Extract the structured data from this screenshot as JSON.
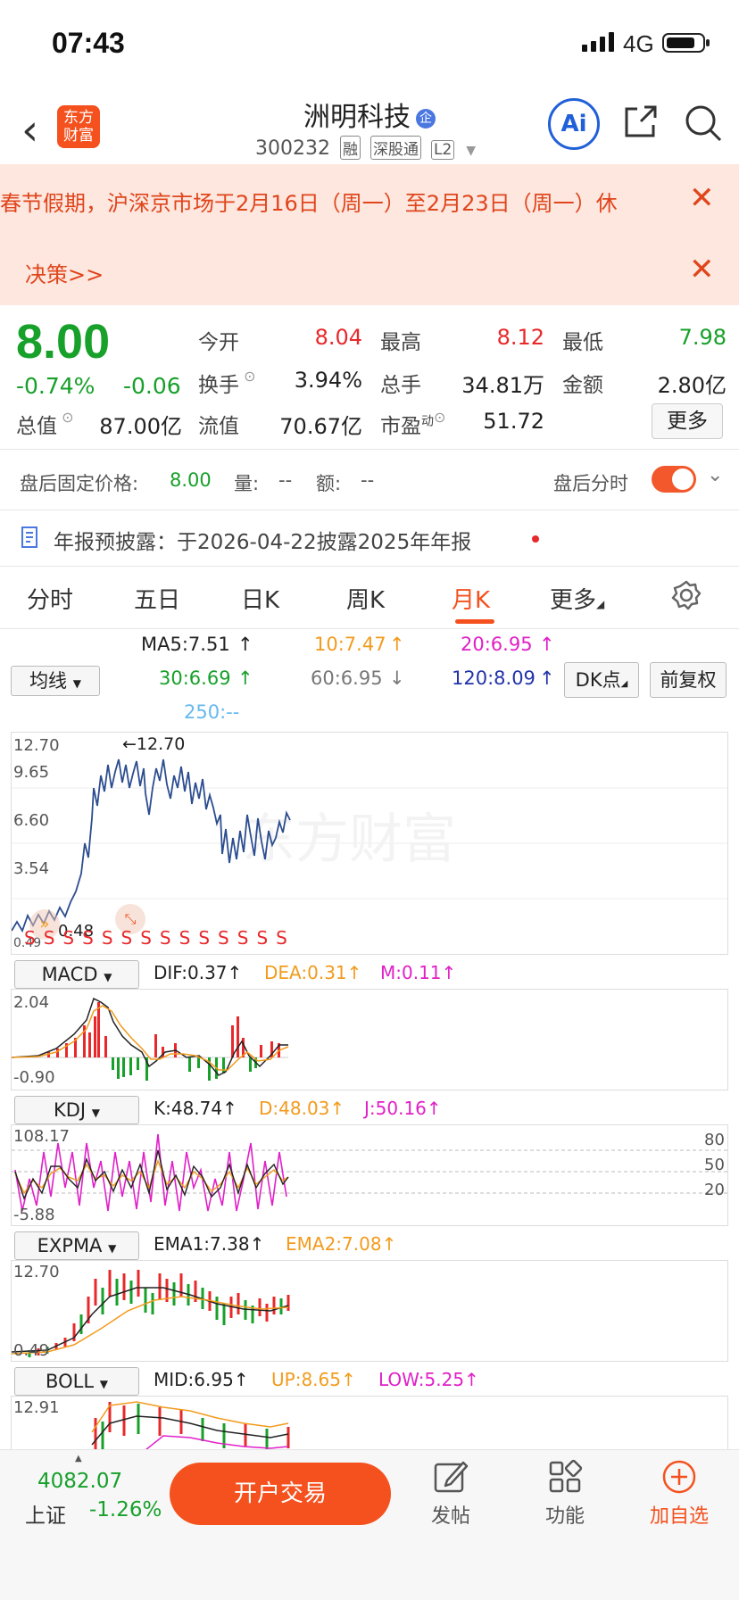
{
  "status_bar": {
    "time": "07:43",
    "network": "4G"
  },
  "header": {
    "logo_text": "东方财富",
    "stock_name": "洲明科技",
    "stock_badge": "企",
    "stock_code": "300232",
    "tags": [
      "融",
      "深股通",
      "L2"
    ],
    "ai_label": "Ai"
  },
  "banner": {
    "line1": "春节假期，沪深京市场于2月16日（周一）至2月23日（周一）休",
    "line2": "决策>>"
  },
  "quote": {
    "price": "8.00",
    "change_pct": "-0.74%",
    "change_amt": "-0.06",
    "open_label": "今开",
    "open": "8.04",
    "high_label": "最高",
    "high": "8.12",
    "low_label": "最低",
    "low": "7.98",
    "turnover_label": "换手",
    "turnover": "3.94%",
    "volume_label": "总手",
    "volume": "34.81万",
    "amount_label": "金额",
    "amount": "2.80亿",
    "mktcap_label": "总值",
    "mktcap": "87.00亿",
    "float_label": "流值",
    "float": "70.67亿",
    "pe_label": "市盈",
    "pe_sup": "动",
    "pe": "51.72",
    "more_label": "更多"
  },
  "after_hours": {
    "fixed_price_label": "盘后固定价格:",
    "fixed_price": "8.00",
    "vol_label": "量:",
    "vol": "--",
    "amt_label": "额:",
    "amt": "--",
    "timeshare_label": "盘后分时"
  },
  "report": {
    "text": "年报预披露：于2026-04-22披露2025年年报"
  },
  "tabs": [
    "分时",
    "五日",
    "日K",
    "周K",
    "月K",
    "更多"
  ],
  "ma": {
    "selector": "均线",
    "ma5": "MA5:7.51",
    "ma10": "10:7.47",
    "ma20": "20:6.95",
    "ma30": "30:6.69",
    "ma60": "60:6.95",
    "ma120": "120:8.09",
    "ma250": "250:--",
    "dk_label": "DK点",
    "adjust_label": "前复权"
  },
  "kline": {
    "y_labels": [
      "12.70",
      "9.65",
      "6.60",
      "3.54",
      "0.49"
    ],
    "max_label": "12.70",
    "min_label": "0.48",
    "signal_marks": [
      "S",
      "S",
      "S",
      "S",
      "S",
      "S",
      "S",
      "S",
      "S",
      "S",
      "S",
      "S",
      "S",
      "S"
    ],
    "watermark": "东方财富"
  },
  "macd": {
    "name": "MACD",
    "dif": "DIF:0.37",
    "dea": "DEA:0.31",
    "m": "M:0.11",
    "y_top": "2.04",
    "y_bottom": "-0.90"
  },
  "kdj": {
    "name": "KDJ",
    "k": "K:48.74",
    "d": "D:48.03",
    "j": "J:50.16",
    "y_top": "108.17",
    "y_bottom": "-5.88",
    "levels": [
      "80",
      "50",
      "20"
    ]
  },
  "expma": {
    "name": "EXPMA",
    "ema1": "EMA1:7.38",
    "ema2": "EMA2:7.08",
    "y_top": "12.70",
    "y_bottom": "0.49"
  },
  "boll": {
    "name": "BOLL",
    "mid": "MID:6.95",
    "up": "UP:8.65",
    "low": "LOW:5.25",
    "y_top": "12.91"
  },
  "footer": {
    "index_value": "4082.07",
    "index_name": "上证",
    "index_change": "-1.26%",
    "trade_label": "开户交易",
    "post_label": "发帖",
    "function_label": "功能",
    "watch_label": "加自选"
  },
  "colors": {
    "up": "#e8282a",
    "down": "#17a02a",
    "accent": "#f4511e",
    "ma10": "#f29b1d",
    "ma20": "#e020c8",
    "ma60": "#777777",
    "ma120": "#2233aa",
    "ma250": "#66b8f0"
  }
}
